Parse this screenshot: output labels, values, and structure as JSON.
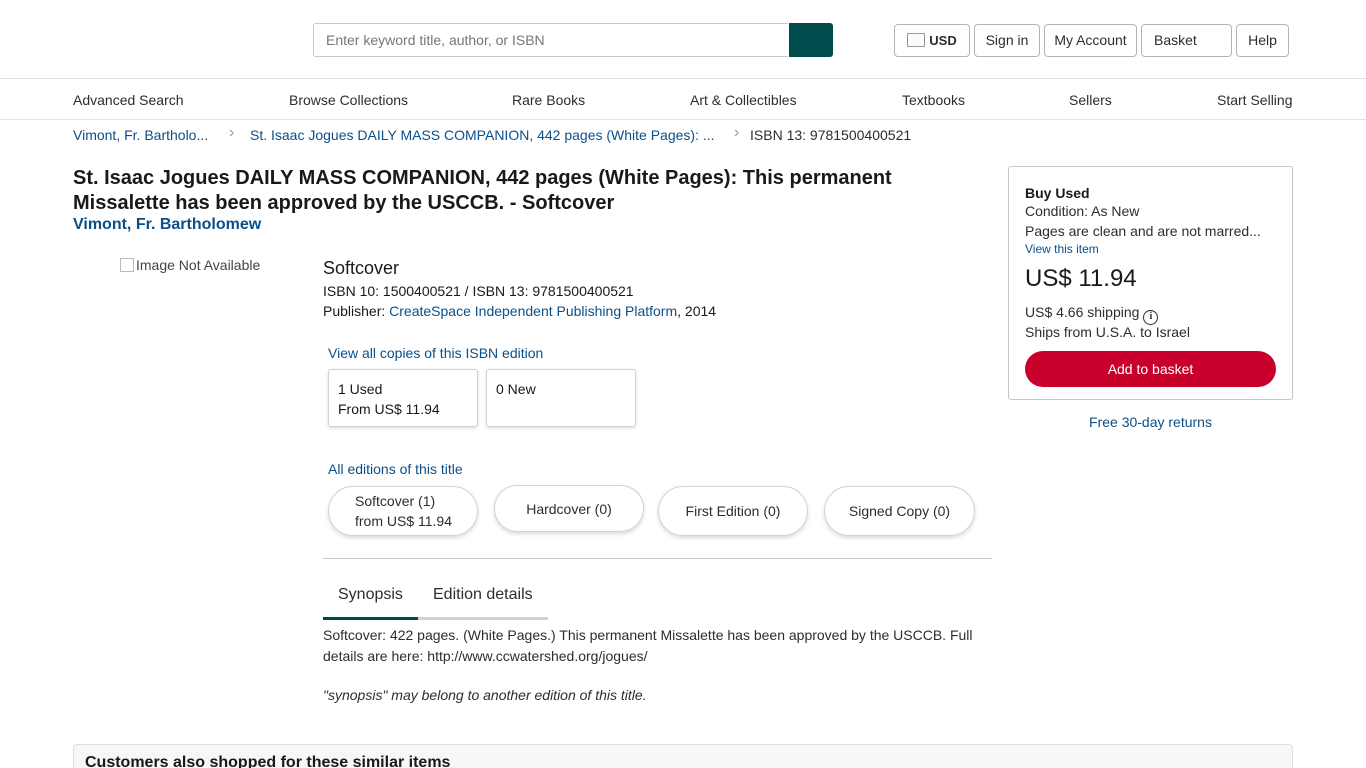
{
  "header": {
    "search_placeholder": "Enter keyword title, author, or ISBN",
    "currency": "USD",
    "sign_in": "Sign in",
    "my_account": "My Account",
    "basket": "Basket",
    "help": "Help",
    "accent_color": "#004c4c"
  },
  "nav": {
    "items": [
      "Advanced Search",
      "Browse Collections",
      "Rare Books",
      "Art & Collectibles",
      "Textbooks",
      "Sellers",
      "Start Selling"
    ]
  },
  "breadcrumb": {
    "items": [
      "Vimont, Fr. Bartholo...",
      "St. Isaac Jogues DAILY MASS COMPANION, 442 pages (White Pages): ...",
      "ISBN 13: 9781500400521"
    ]
  },
  "product": {
    "title": "St. Isaac Jogues DAILY MASS COMPANION, 442 pages (White Pages): This permanent Missalette has been approved by the USCCB. - Softcover",
    "author": "Vimont, Fr. Bartholomew",
    "image_alt": "Image Not Available",
    "binding": "Softcover",
    "isbns": "ISBN 10: 1500400521 / ISBN 13: 9781500400521",
    "publisher_label": "Publisher: ",
    "publisher_name": "CreateSpace Independent Publishing Platform",
    "publisher_year": ", 2014"
  },
  "copies": {
    "view_all": "View all copies of this ISBN edition",
    "used_count": "1 Used",
    "used_from": "From US$ 11.94",
    "new_count": "0 New"
  },
  "editions": {
    "all_editions": "All editions of this title",
    "softcover": "Softcover (1)",
    "softcover_from": "from US$ 11.94",
    "hardcover": "Hardcover (0)",
    "first_edition": "First Edition (0)",
    "signed_copy": "Signed Copy (0)"
  },
  "tabs": {
    "synopsis": "Synopsis",
    "edition_details": "Edition details"
  },
  "synopsis": {
    "text": "Softcover: 422 pages. (White Pages.) This permanent Missalette has been approved by the USCCB. Full details are here: http://www.ccwatershed.org/jogues/",
    "note": "\"synopsis\" may belong to another edition of this title."
  },
  "buybox": {
    "title": "Buy Used",
    "condition": "Condition: As New",
    "description": "Pages are clean and are not marred...",
    "view_item": "View this item",
    "price": "US$ 11.94",
    "shipping": "US$ 4.66 shipping",
    "ships_from": "Ships from U.S.A. to Israel",
    "add_to_basket": "Add to basket",
    "button_color": "#c8002b"
  },
  "returns": "Free 30-day returns",
  "similar": {
    "title": "Customers also shopped for these similar items"
  }
}
